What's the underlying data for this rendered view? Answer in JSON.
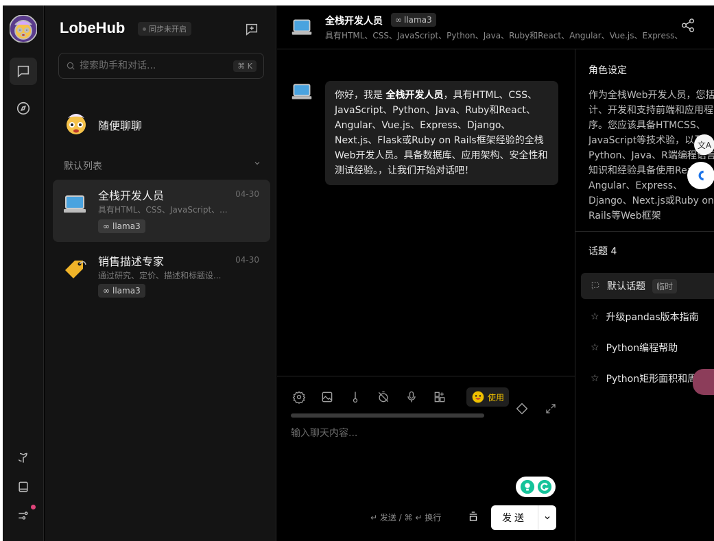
{
  "brand": "LobeHub",
  "sync_status": "同步未开启",
  "search": {
    "placeholder": "搜索助手和对话...",
    "shortcut": "⌘ K"
  },
  "inbox": {
    "title": "随便聊聊"
  },
  "section": {
    "label": "默认列表"
  },
  "sessions": [
    {
      "title": "全栈开发人员",
      "desc": "具有HTML、CSS、JavaScript、...",
      "date": "04-30",
      "model": "llama3"
    },
    {
      "title": "销售描述专家",
      "desc": "通过研究、定价、描述和标题设...",
      "date": "04-30",
      "model": "llama3"
    }
  ],
  "header": {
    "title": "全栈开发人员",
    "model": "llama3",
    "desc": "具有HTML、CSS、JavaScript、Python、Java、Ruby和React、Angular、Vue.js、Express、"
  },
  "message": {
    "prefix": "你好，我是",
    "name": "全栈开发人员",
    "body": "，具有HTML、CSS、JavaScript、Python、Java、Ruby和React、Angular、Vue.js、Express、Django、Next.js、Flask或Ruby on Rails框架经验的全栈Web开发人员。具备数据库、应用架构、安全性和测试经验。，让我们开始对话吧！"
  },
  "composer": {
    "use_label": "使用",
    "placeholder": "输入聊天内容...",
    "hint": "↵ 发送 / ⌘ ↵ 换行",
    "send_label": "发送"
  },
  "role_panel": {
    "title": "角色设定",
    "desc": "作为全栈Web开发人员，您括设计、开发和支持前端和应用程序。您应该具备HTMCSS、JavaScript等技术验，以及Python、Java、R端编程语言的知识和经验具备使用React、Angular、Express、Django、Next.js或Ruby on Rails等Web框架"
  },
  "topics": {
    "title": "话题 4",
    "items": [
      {
        "label": "默认话题",
        "tag": "临时"
      },
      {
        "label": "升级pandas版本指南"
      },
      {
        "label": "Python编程帮助"
      },
      {
        "label": "Python矩形面积和周长"
      }
    ]
  },
  "translate_badge": "文A",
  "colors": {
    "accent": "#ffffff",
    "notification": "#e0447a",
    "emoji_pill": "#f0c000"
  }
}
